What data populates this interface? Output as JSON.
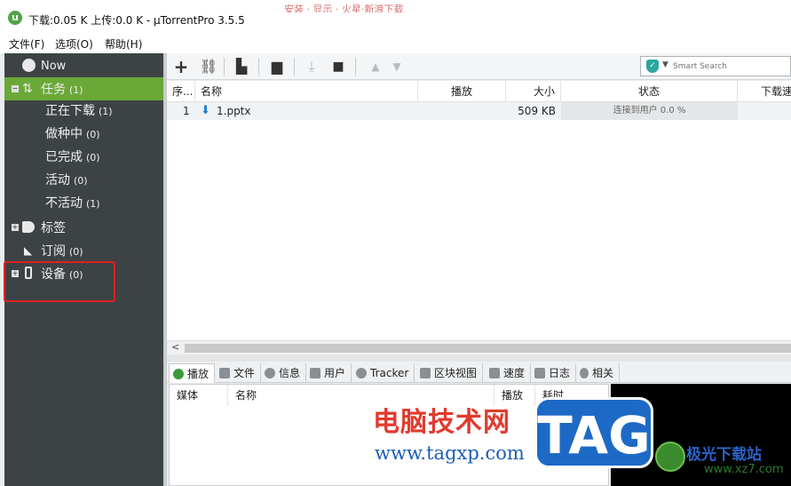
{
  "window": {
    "title": "下载:0.05 K 上传:0.0 K - µTorrentPro 3.5.5",
    "logo_letter": "u",
    "background_text": "安装 · 显示 · 火星·新浪下载"
  },
  "menu": [
    "文件(F)",
    "选项(O)",
    "帮助(H)"
  ],
  "sidebar": {
    "now": "Now",
    "tasks": {
      "label": "任务",
      "count": "(1)"
    },
    "sub": [
      {
        "label": "正在下载",
        "count": "(1)"
      },
      {
        "label": "做种中",
        "count": "(0)"
      },
      {
        "label": "已完成",
        "count": "(0)"
      },
      {
        "label": "活动",
        "count": "(0)"
      },
      {
        "label": "不活动",
        "count": "(1)"
      }
    ],
    "labels": {
      "label": "标签"
    },
    "feeds": {
      "label": "订阅",
      "count": "(0)"
    },
    "devices": {
      "label": "设备",
      "count": "(0)"
    }
  },
  "toolbar": {
    "icons": [
      "add-icon",
      "add-link-icon",
      "create-icon",
      "remove-icon",
      "download-icon",
      "stop-icon",
      "up-icon",
      "down-icon"
    ]
  },
  "search": {
    "placeholder": "Smart Search"
  },
  "grid": {
    "headers": [
      "序...",
      "名称",
      "播放",
      "大小",
      "状态",
      "下载速"
    ],
    "rows": [
      {
        "num": "1",
        "name": "1.pptx",
        "size": "509 KB",
        "status": "连接到用户 0.0 %"
      }
    ]
  },
  "tabs": [
    "播放",
    "文件",
    "信息",
    "用户",
    "Tracker",
    "区块视图",
    "速度",
    "日志",
    "相关"
  ],
  "media": {
    "headers": [
      "媒体",
      "名称",
      "播放",
      "耗时"
    ]
  },
  "watermark": {
    "site_cn": "电脑技术网",
    "site_url": "www.tagxp.com",
    "tag": "TAG",
    "right_cn": "极光下载站",
    "right_url": "www.xz7.com"
  },
  "colors": {
    "sidebar_bg": "#3d4345",
    "selected_green": "#6aa938",
    "highlight_red": "#e02020"
  }
}
